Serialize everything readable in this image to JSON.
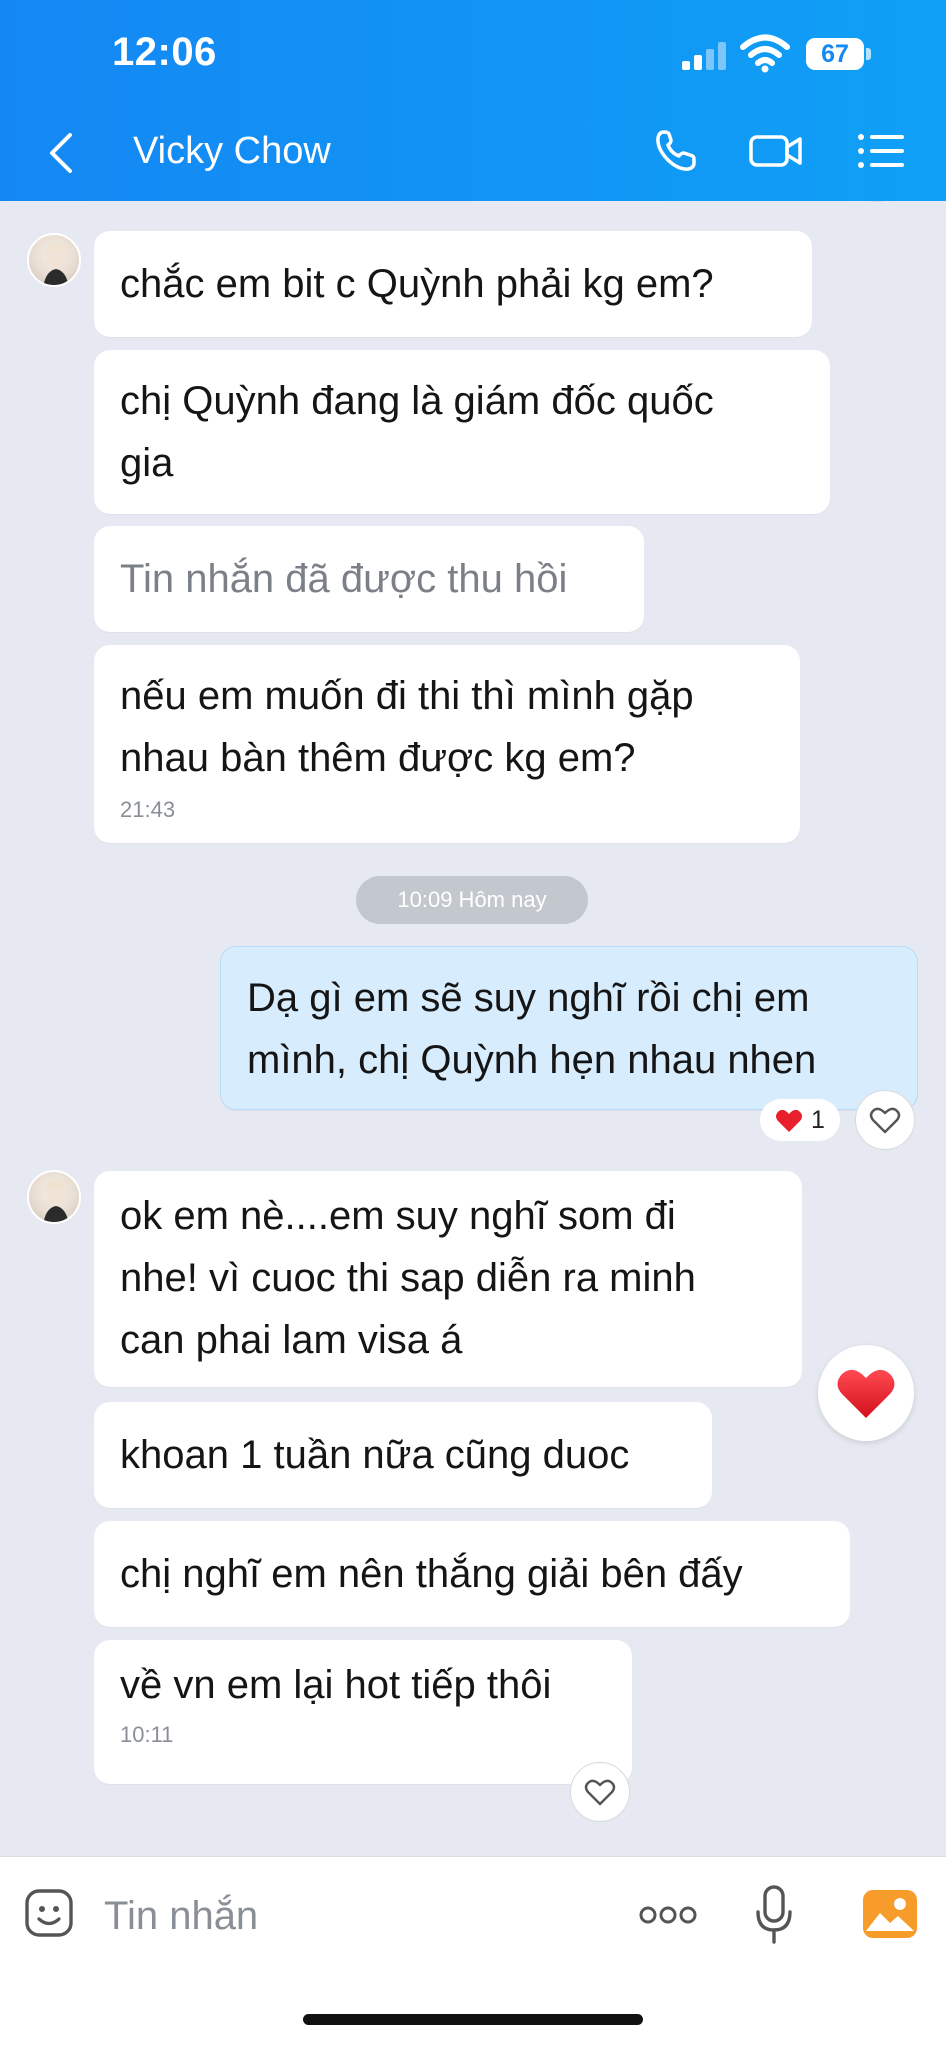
{
  "status_bar": {
    "time": "12:06",
    "battery": "67"
  },
  "header": {
    "contact_name": "Vicky Chow"
  },
  "messages": [
    {
      "text": "chắc em bit c Quỳnh phải kg em?"
    },
    {
      "text": "chị Quỳnh đang là giám đốc quốc\ngia"
    },
    {
      "text": "Tin nhắn đã được thu hồi"
    },
    {
      "text": "nếu em muốn đi thi thì mình gặp\nnhau bàn thêm được kg em?",
      "time": "21:43"
    },
    {
      "text": "Dạ gì em sẽ suy nghĩ rồi chị em\nmình, chị Quỳnh hẹn nhau nhen"
    },
    {
      "text": "ok em nè....em suy nghĩ som đi\nnhe! vì cuoc thi sap diễn ra minh\ncan phai lam visa á"
    },
    {
      "text": "khoan 1 tuần nữa cũng duoc"
    },
    {
      "text": "chị nghĩ em nên thắng giải bên đấy"
    },
    {
      "text": "về vn em lại hot tiếp thôi",
      "time": "10:11"
    }
  ],
  "date_separator": "10:09 Hôm nay",
  "reaction": {
    "count": "1"
  },
  "composer": {
    "placeholder": "Tin nhắn"
  },
  "colors": {
    "header": "#1487f3",
    "mine_bubble": "#d7ecfd",
    "heart": "#e8202c"
  }
}
